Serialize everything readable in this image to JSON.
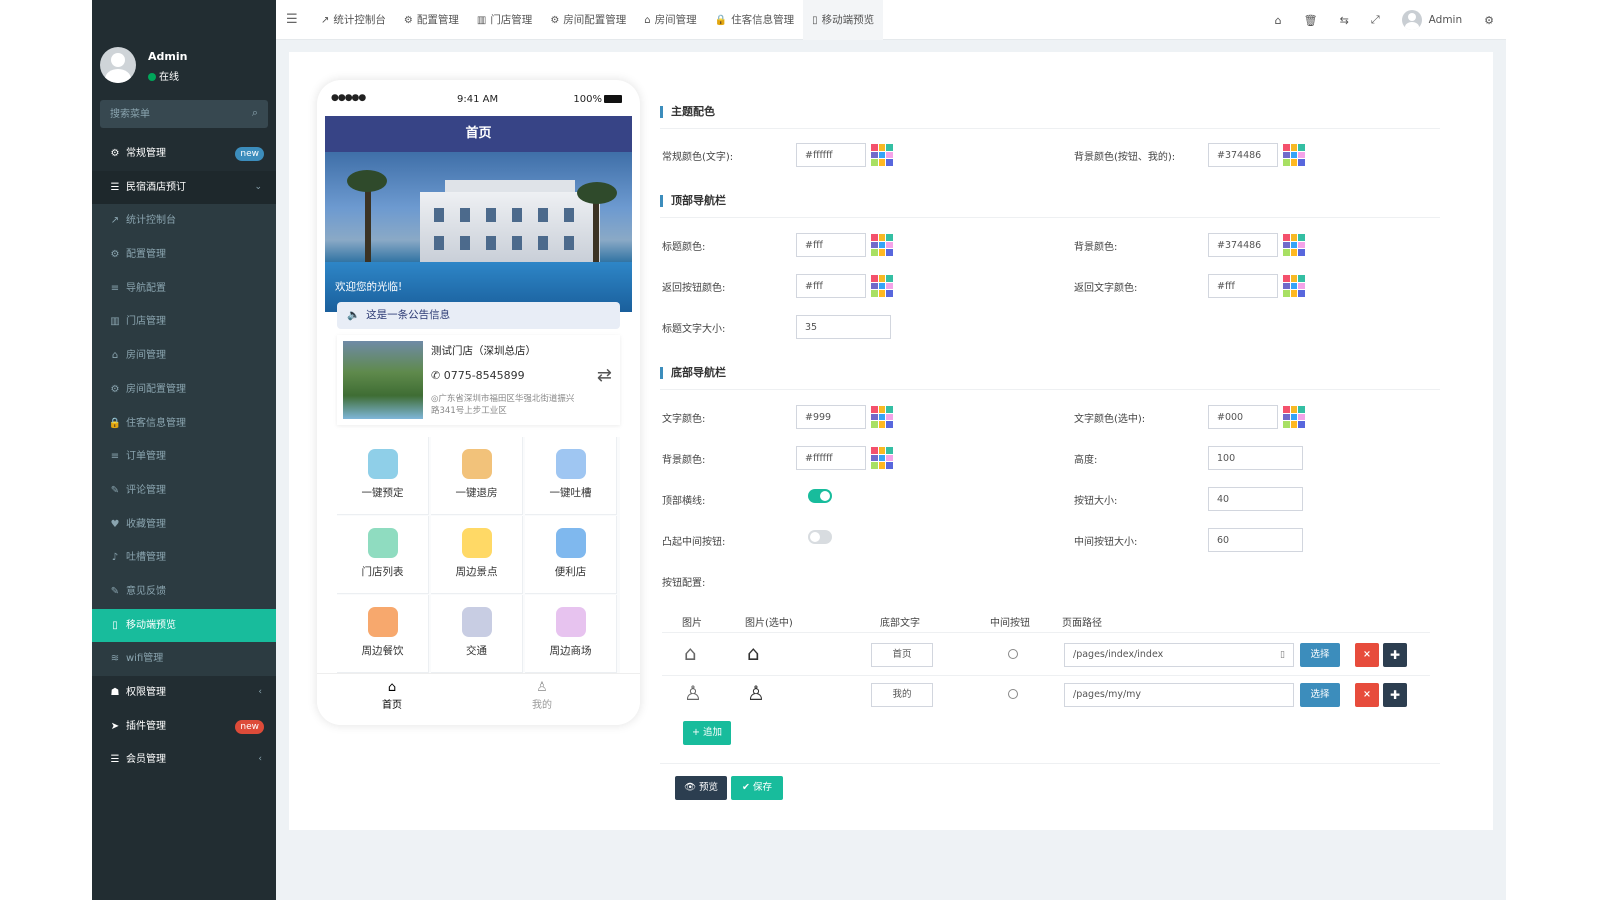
{
  "sidebar": {
    "user_name": "Admin",
    "user_status": "在线",
    "search_placeholder": "搜索菜单",
    "items": [
      {
        "label": "常规管理",
        "icon": "cogs-icon",
        "glyph": "⚙",
        "badge": "new",
        "badge_color": "#3c8dbc",
        "kind": "top"
      },
      {
        "label": "民宿酒店预订",
        "icon": "list-icon",
        "glyph": "☰",
        "caret": "⌄",
        "kind": "open"
      },
      {
        "label": "统计控制台",
        "icon": "chart-icon",
        "glyph": "↗",
        "kind": "sub"
      },
      {
        "label": "配置管理",
        "icon": "gear-icon",
        "glyph": "⚙",
        "kind": "sub"
      },
      {
        "label": "导航配置",
        "icon": "list-icon",
        "glyph": "≡",
        "kind": "sub"
      },
      {
        "label": "门店管理",
        "icon": "bank-icon",
        "glyph": "▥",
        "kind": "sub"
      },
      {
        "label": "房间管理",
        "icon": "home-icon",
        "glyph": "⌂",
        "kind": "sub"
      },
      {
        "label": "房间配置管理",
        "icon": "gear-icon",
        "glyph": "⚙",
        "kind": "sub"
      },
      {
        "label": "住客信息管理",
        "icon": "lock-icon",
        "glyph": "🔒",
        "kind": "sub"
      },
      {
        "label": "订单管理",
        "icon": "list-icon",
        "glyph": "≡",
        "kind": "sub"
      },
      {
        "label": "评论管理",
        "icon": "comments-icon",
        "glyph": "✎",
        "kind": "sub"
      },
      {
        "label": "收藏管理",
        "icon": "heart-icon",
        "glyph": "♥",
        "kind": "sub"
      },
      {
        "label": "吐槽管理",
        "icon": "microphone-icon",
        "glyph": "♪",
        "kind": "sub"
      },
      {
        "label": "意见反馈",
        "icon": "pencil-icon",
        "glyph": "✎",
        "kind": "sub"
      },
      {
        "label": "移动端预览",
        "icon": "mobile-icon",
        "glyph": "▯",
        "kind": "active"
      },
      {
        "label": "wifi管理",
        "icon": "wifi-icon",
        "glyph": "≋",
        "kind": "sub"
      },
      {
        "label": "权限管理",
        "icon": "group-icon",
        "glyph": "☗",
        "caret": "‹",
        "kind": "top"
      },
      {
        "label": "插件管理",
        "icon": "rocket-icon",
        "glyph": "➤",
        "badge": "new",
        "badge_color": "#dd4b39",
        "kind": "top"
      },
      {
        "label": "会员管理",
        "icon": "list-icon",
        "glyph": "☰",
        "caret": "‹",
        "kind": "top"
      }
    ]
  },
  "topbar": {
    "tabs": [
      {
        "label": "统计控制台",
        "glyph": "↗"
      },
      {
        "label": "配置管理",
        "glyph": "⚙"
      },
      {
        "label": "门店管理",
        "glyph": "▥"
      },
      {
        "label": "房间配置管理",
        "glyph": "⚙"
      },
      {
        "label": "房间管理",
        "glyph": "⌂"
      },
      {
        "label": "住客信息管理",
        "glyph": "🔒"
      },
      {
        "label": "移动端预览",
        "glyph": "▯"
      }
    ],
    "right_icons": [
      "home-icon",
      "trash-icon",
      "language-icon",
      "fullscreen-icon"
    ],
    "right_glyphs": [
      "⌂",
      "🗑",
      "⇆",
      "⤢"
    ],
    "user": "Admin"
  },
  "phone": {
    "signal": "●●●●●",
    "time": "9:41 AM",
    "battery": "100%",
    "nav_title": "首页",
    "welcome": "欢迎您的光临!",
    "notice": "这是一条公告信息",
    "store": {
      "name": "测试门店（深圳总店）",
      "phone": "0775-8545899",
      "address": "◎广东省深圳市福田区华强北街道振兴路341号上步工业区"
    },
    "grid": [
      {
        "label": "一键预定",
        "color": "#8fcfe8"
      },
      {
        "label": "一键退房",
        "color": "#f2c27a"
      },
      {
        "label": "一键吐槽",
        "color": "#9fc6f2"
      },
      {
        "label": "门店列表",
        "color": "#8fdcc0"
      },
      {
        "label": "周边景点",
        "color": "#ffd966"
      },
      {
        "label": "便利店",
        "color": "#7fb8ee"
      },
      {
        "label": "周边餐饮",
        "color": "#f7a86d"
      },
      {
        "label": "交通",
        "color": "#c8cde3"
      },
      {
        "label": "周边商场",
        "color": "#e7c3ef"
      }
    ],
    "tabbar": [
      {
        "label": "首页",
        "active": true
      },
      {
        "label": "我的",
        "active": false
      }
    ]
  },
  "settings": {
    "theme": {
      "title": "主题配色",
      "text_color_label": "常规颜色(文字):",
      "text_color": "#ffffff",
      "bg_color_label": "背景颜色(按钮、我的):",
      "bg_color": "#374486"
    },
    "top_nav": {
      "title": "顶部导航栏",
      "title_color_label": "标题颜色:",
      "title_color": "#fff",
      "bg_color_label": "背景颜色:",
      "bg_color": "#374486",
      "back_btn_color_label": "返回按钮颜色:",
      "back_btn_color": "#fff",
      "back_text_color_label": "返回文字颜色:",
      "back_text_color": "#fff",
      "title_size_label": "标题文字大小:",
      "title_size": "35"
    },
    "bottom_nav": {
      "title": "底部导航栏",
      "text_color_label": "文字颜色:",
      "text_color": "#999",
      "text_active_color_label": "文字颜色(选中):",
      "text_active_color": "#000",
      "bg_color_label": "背景颜色:",
      "bg_color": "#ffffff",
      "height_label": "高度:",
      "height": "100",
      "top_line_label": "顶部横线:",
      "top_line": true,
      "btn_size_label": "按钮大小:",
      "btn_size": "40",
      "raised_middle_label": "凸起中间按钮:",
      "raised_middle": false,
      "middle_btn_size_label": "中间按钮大小:",
      "middle_btn_size": "60",
      "buttons_label": "按钮配置:"
    },
    "table": {
      "headers": [
        "图片",
        "图片(选中)",
        "底部文字",
        "中间按钮",
        "页面路径"
      ],
      "rows": [
        {
          "text": "首页",
          "path": "/pages/index/index",
          "icon": "home-outline-icon"
        },
        {
          "text": "我的",
          "path": "/pages/my/my",
          "icon": "user-outline-icon"
        }
      ],
      "select_label": "选择",
      "remove_label": "×",
      "move_label": "✚",
      "add_label": "+ 追加"
    },
    "actions": {
      "preview_label": "👁 预览",
      "save_label": "✔ 保存"
    }
  },
  "palette_colors": [
    "#f4516c",
    "#f7b924",
    "#34bfa3",
    "#716aca",
    "#36a3f7",
    "#f4a3e9",
    "#a8e063",
    "#ffb822",
    "#5867dd"
  ]
}
